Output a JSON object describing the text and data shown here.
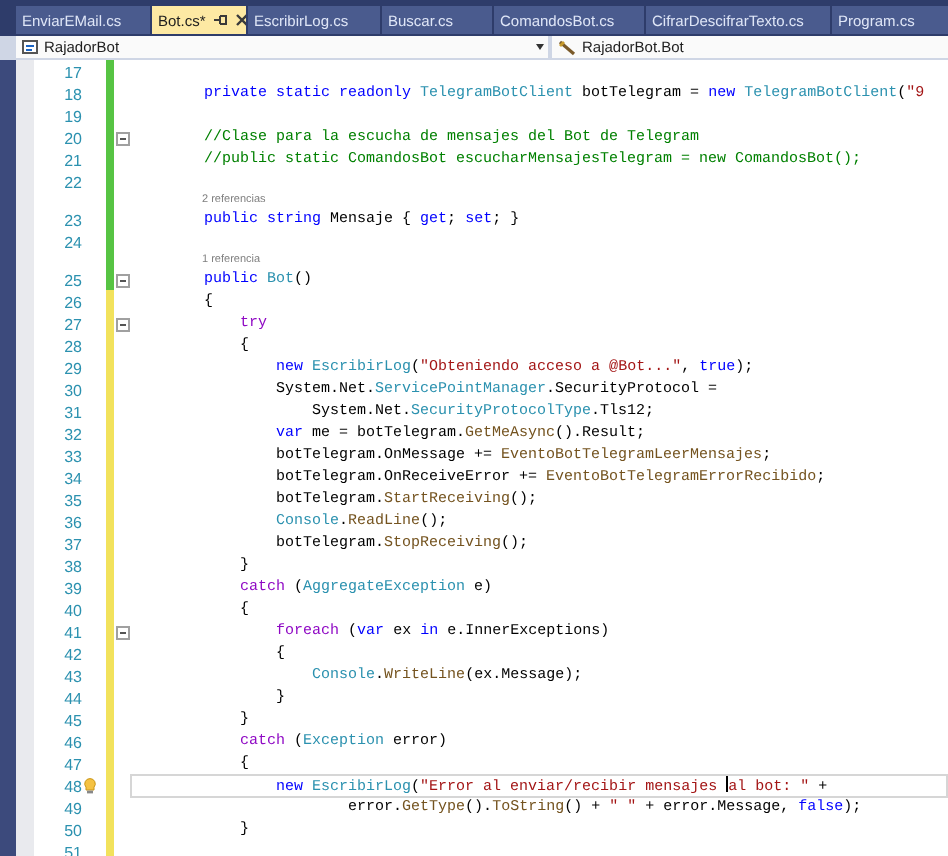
{
  "tabs": [
    {
      "label": "EnviarEMail.cs",
      "selected": false
    },
    {
      "label": "Bot.cs*",
      "selected": true
    },
    {
      "label": "EscribirLog.cs",
      "selected": false
    },
    {
      "label": "Buscar.cs",
      "selected": false
    },
    {
      "label": "ComandosBot.cs",
      "selected": false
    },
    {
      "label": "CifrarDescifrarTexto.cs",
      "selected": false
    },
    {
      "label": "Program.cs",
      "selected": false
    }
  ],
  "navigation": {
    "project": "RajadorBot",
    "member": "RajadorBot.Bot"
  },
  "lines": [
    {
      "number": "17",
      "color": "#57c443",
      "fold": false,
      "current": false,
      "lightbulb": false
    },
    {
      "number": "18",
      "color": "#57c443",
      "fold": false,
      "current": false,
      "lightbulb": false,
      "tokens": [
        {
          "kind": "keyword",
          "text": "        private static readonly "
        },
        {
          "kind": "type",
          "text": "TelegramBotClient"
        },
        {
          "kind": "plain",
          "text": " botTelegram = "
        },
        {
          "kind": "keyword",
          "text": "new "
        },
        {
          "kind": "type",
          "text": "TelegramBotClient"
        },
        {
          "kind": "plain",
          "text": "("
        },
        {
          "kind": "string",
          "text": "\"9"
        }
      ]
    },
    {
      "number": "19",
      "color": "#57c443",
      "fold": false,
      "current": false,
      "lightbulb": false
    },
    {
      "number": "20",
      "color": "#57c443",
      "fold": true,
      "current": false,
      "lightbulb": false,
      "tokens": [
        {
          "kind": "comment",
          "text": "        //Clase para la escucha de mensajes del Bot de Telegram"
        }
      ]
    },
    {
      "number": "21",
      "color": "#57c443",
      "fold": false,
      "current": false,
      "lightbulb": false,
      "tokens": [
        {
          "kind": "comment",
          "text": "        //public static ComandosBot escucharMensajesTelegram = new ComandosBot();"
        }
      ]
    },
    {
      "number": "22",
      "color": "#57c443",
      "fold": false,
      "current": false,
      "lightbulb": false
    },
    {
      "number": "23",
      "color": "#57c443",
      "fold": false,
      "current": false,
      "lightbulb": false,
      "reference": "2 referencias",
      "tokens": [
        {
          "kind": "keyword",
          "text": "        public string"
        },
        {
          "kind": "plain",
          "text": " Mensaje { "
        },
        {
          "kind": "keyword",
          "text": "get"
        },
        {
          "kind": "plain",
          "text": "; "
        },
        {
          "kind": "keyword",
          "text": "set"
        },
        {
          "kind": "plain",
          "text": "; }"
        }
      ]
    },
    {
      "number": "24",
      "color": "#57c443",
      "fold": false,
      "current": false,
      "lightbulb": false
    },
    {
      "number": "25",
      "color": "#57c443",
      "fold": true,
      "current": false,
      "lightbulb": false,
      "reference": "1 referencia",
      "tokens": [
        {
          "kind": "keyword",
          "text": "        public "
        },
        {
          "kind": "type",
          "text": "Bot"
        },
        {
          "kind": "plain",
          "text": "()"
        }
      ]
    },
    {
      "number": "26",
      "color": "#f2e25c",
      "fold": false,
      "current": false,
      "lightbulb": false,
      "tokens": [
        {
          "kind": "plain",
          "text": "        {"
        }
      ]
    },
    {
      "number": "27",
      "color": "#f2e25c",
      "fold": true,
      "current": false,
      "lightbulb": false,
      "tokens": [
        {
          "kind": "control",
          "text": "            try"
        }
      ]
    },
    {
      "number": "28",
      "color": "#f2e25c",
      "fold": false,
      "current": false,
      "lightbulb": false,
      "tokens": [
        {
          "kind": "plain",
          "text": "            {"
        }
      ]
    },
    {
      "number": "29",
      "color": "#f2e25c",
      "fold": false,
      "current": false,
      "lightbulb": false,
      "tokens": [
        {
          "kind": "keyword",
          "text": "                new "
        },
        {
          "kind": "type",
          "text": "EscribirLog"
        },
        {
          "kind": "plain",
          "text": "("
        },
        {
          "kind": "string",
          "text": "\"Obteniendo acceso a @Bot...\""
        },
        {
          "kind": "plain",
          "text": ", "
        },
        {
          "kind": "keyword",
          "text": "true"
        },
        {
          "kind": "plain",
          "text": ");"
        }
      ]
    },
    {
      "number": "30",
      "color": "#f2e25c",
      "fold": false,
      "current": false,
      "lightbulb": false,
      "tokens": [
        {
          "kind": "plain",
          "text": "                System.Net."
        },
        {
          "kind": "type",
          "text": "ServicePointManager"
        },
        {
          "kind": "plain",
          "text": ".SecurityProtocol ="
        }
      ]
    },
    {
      "number": "31",
      "color": "#f2e25c",
      "fold": false,
      "current": false,
      "lightbulb": false,
      "tokens": [
        {
          "kind": "plain",
          "text": "                    System.Net."
        },
        {
          "kind": "type",
          "text": "SecurityProtocolType"
        },
        {
          "kind": "plain",
          "text": ".Tls12;"
        }
      ]
    },
    {
      "number": "32",
      "color": "#f2e25c",
      "fold": false,
      "current": false,
      "lightbulb": false,
      "tokens": [
        {
          "kind": "keyword",
          "text": "                var"
        },
        {
          "kind": "plain",
          "text": " me = botTelegram."
        },
        {
          "kind": "method",
          "text": "GetMeAsync"
        },
        {
          "kind": "plain",
          "text": "().Result;"
        }
      ]
    },
    {
      "number": "33",
      "color": "#f2e25c",
      "fold": false,
      "current": false,
      "lightbulb": false,
      "tokens": [
        {
          "kind": "plain",
          "text": "                botTelegram.OnMessage += "
        },
        {
          "kind": "method",
          "text": "EventoBotTelegramLeerMensajes"
        },
        {
          "kind": "plain",
          "text": ";"
        }
      ]
    },
    {
      "number": "34",
      "color": "#f2e25c",
      "fold": false,
      "current": false,
      "lightbulb": false,
      "tokens": [
        {
          "kind": "plain",
          "text": "                botTelegram.OnReceiveError += "
        },
        {
          "kind": "method",
          "text": "EventoBotTelegramErrorRecibido"
        },
        {
          "kind": "plain",
          "text": ";"
        }
      ]
    },
    {
      "number": "35",
      "color": "#f2e25c",
      "fold": false,
      "current": false,
      "lightbulb": false,
      "tokens": [
        {
          "kind": "plain",
          "text": "                botTelegram."
        },
        {
          "kind": "method",
          "text": "StartReceiving"
        },
        {
          "kind": "plain",
          "text": "();"
        }
      ]
    },
    {
      "number": "36",
      "color": "#f2e25c",
      "fold": false,
      "current": false,
      "lightbulb": false,
      "tokens": [
        {
          "kind": "type",
          "text": "                Console"
        },
        {
          "kind": "plain",
          "text": "."
        },
        {
          "kind": "method",
          "text": "ReadLine"
        },
        {
          "kind": "plain",
          "text": "();"
        }
      ]
    },
    {
      "number": "37",
      "color": "#f2e25c",
      "fold": false,
      "current": false,
      "lightbulb": false,
      "tokens": [
        {
          "kind": "plain",
          "text": "                botTelegram."
        },
        {
          "kind": "method",
          "text": "StopReceiving"
        },
        {
          "kind": "plain",
          "text": "();"
        }
      ]
    },
    {
      "number": "38",
      "color": "#f2e25c",
      "fold": false,
      "current": false,
      "lightbulb": false,
      "tokens": [
        {
          "kind": "plain",
          "text": "            }"
        }
      ]
    },
    {
      "number": "39",
      "color": "#f2e25c",
      "fold": false,
      "current": false,
      "lightbulb": false,
      "tokens": [
        {
          "kind": "control",
          "text": "            catch"
        },
        {
          "kind": "plain",
          "text": " ("
        },
        {
          "kind": "type",
          "text": "AggregateException"
        },
        {
          "kind": "plain",
          "text": " e)"
        }
      ]
    },
    {
      "number": "40",
      "color": "#f2e25c",
      "fold": false,
      "current": false,
      "lightbulb": false,
      "tokens": [
        {
          "kind": "plain",
          "text": "            {"
        }
      ]
    },
    {
      "number": "41",
      "color": "#f2e25c",
      "fold": true,
      "current": false,
      "lightbulb": false,
      "tokens": [
        {
          "kind": "control",
          "text": "                foreach"
        },
        {
          "kind": "plain",
          "text": " ("
        },
        {
          "kind": "keyword",
          "text": "var"
        },
        {
          "kind": "plain",
          "text": " ex "
        },
        {
          "kind": "keyword",
          "text": "in"
        },
        {
          "kind": "plain",
          "text": " e.InnerExceptions)"
        }
      ]
    },
    {
      "number": "42",
      "color": "#f2e25c",
      "fold": false,
      "current": false,
      "lightbulb": false,
      "tokens": [
        {
          "kind": "plain",
          "text": "                {"
        }
      ]
    },
    {
      "number": "43",
      "color": "#f2e25c",
      "fold": false,
      "current": false,
      "lightbulb": false,
      "tokens": [
        {
          "kind": "type",
          "text": "                    Console"
        },
        {
          "kind": "plain",
          "text": "."
        },
        {
          "kind": "method",
          "text": "WriteLine"
        },
        {
          "kind": "plain",
          "text": "(ex.Message);"
        }
      ]
    },
    {
      "number": "44",
      "color": "#f2e25c",
      "fold": false,
      "current": false,
      "lightbulb": false,
      "tokens": [
        {
          "kind": "plain",
          "text": "                }"
        }
      ]
    },
    {
      "number": "45",
      "color": "#f2e25c",
      "fold": false,
      "current": false,
      "lightbulb": false,
      "tokens": [
        {
          "kind": "plain",
          "text": "            }"
        }
      ]
    },
    {
      "number": "46",
      "color": "#f2e25c",
      "fold": false,
      "current": false,
      "lightbulb": false,
      "tokens": [
        {
          "kind": "control",
          "text": "            catch"
        },
        {
          "kind": "plain",
          "text": " ("
        },
        {
          "kind": "type",
          "text": "Exception"
        },
        {
          "kind": "plain",
          "text": " error)"
        }
      ]
    },
    {
      "number": "47",
      "color": "#f2e25c",
      "fold": false,
      "current": false,
      "lightbulb": false,
      "tokens": [
        {
          "kind": "plain",
          "text": "            {"
        }
      ]
    },
    {
      "number": "48",
      "color": "#f2e25c",
      "fold": false,
      "current": true,
      "lightbulb": true,
      "tokens": [
        {
          "kind": "keyword",
          "text": "                new "
        },
        {
          "kind": "type",
          "text": "EscribirLog"
        },
        {
          "kind": "plain",
          "text": "("
        },
        {
          "kind": "string",
          "text": "\"Error al enviar/recibir mensajes "
        },
        {
          "kind": "caret"
        },
        {
          "kind": "string",
          "text": "al bot: \""
        },
        {
          "kind": "plain",
          "text": " +"
        }
      ]
    },
    {
      "number": "49",
      "color": "#f2e25c",
      "fold": false,
      "current": false,
      "lightbulb": false,
      "tokens": [
        {
          "kind": "plain",
          "text": "                        error."
        },
        {
          "kind": "method",
          "text": "GetType"
        },
        {
          "kind": "plain",
          "text": "()."
        },
        {
          "kind": "method",
          "text": "ToString"
        },
        {
          "kind": "plain",
          "text": "() + "
        },
        {
          "kind": "string",
          "text": "\" \""
        },
        {
          "kind": "plain",
          "text": " + error.Message, "
        },
        {
          "kind": "keyword",
          "text": "false"
        },
        {
          "kind": "plain",
          "text": ");"
        }
      ]
    },
    {
      "number": "50",
      "color": "#f2e25c",
      "fold": false,
      "current": false,
      "lightbulb": false,
      "tokens": [
        {
          "kind": "plain",
          "text": "            }"
        }
      ]
    },
    {
      "number": "51",
      "color": "#f2e25c",
      "fold": false,
      "current": false,
      "lightbulb": false
    }
  ]
}
